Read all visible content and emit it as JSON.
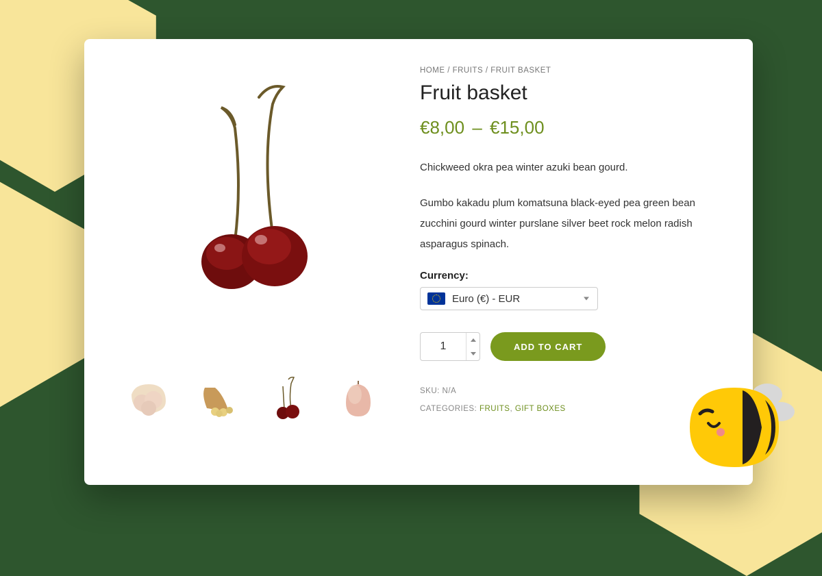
{
  "breadcrumb": {
    "home": "HOME",
    "sep": " / ",
    "fruits": "FRUITS",
    "current": "FRUIT BASKET"
  },
  "product": {
    "title": "Fruit basket",
    "price_low": "€8,00",
    "price_sep": "–",
    "price_high": "€15,00",
    "desc1": "Chickweed okra pea winter azuki bean gourd.",
    "desc2": "Gumbo kakadu plum komatsuna black-eyed pea green bean zucchini gourd winter purslane silver beet rock melon radish asparagus spinach."
  },
  "currency": {
    "label": "Currency:",
    "selected": "Euro (€) - EUR"
  },
  "cart": {
    "quantity": "1",
    "button": "ADD TO CART"
  },
  "meta": {
    "sku_label": "SKU:",
    "sku_value": "N/A",
    "cat_label": "CATEGORIES:",
    "cat1": "FRUITS",
    "cat_sep": ", ",
    "cat2": "GIFT BOXES"
  }
}
